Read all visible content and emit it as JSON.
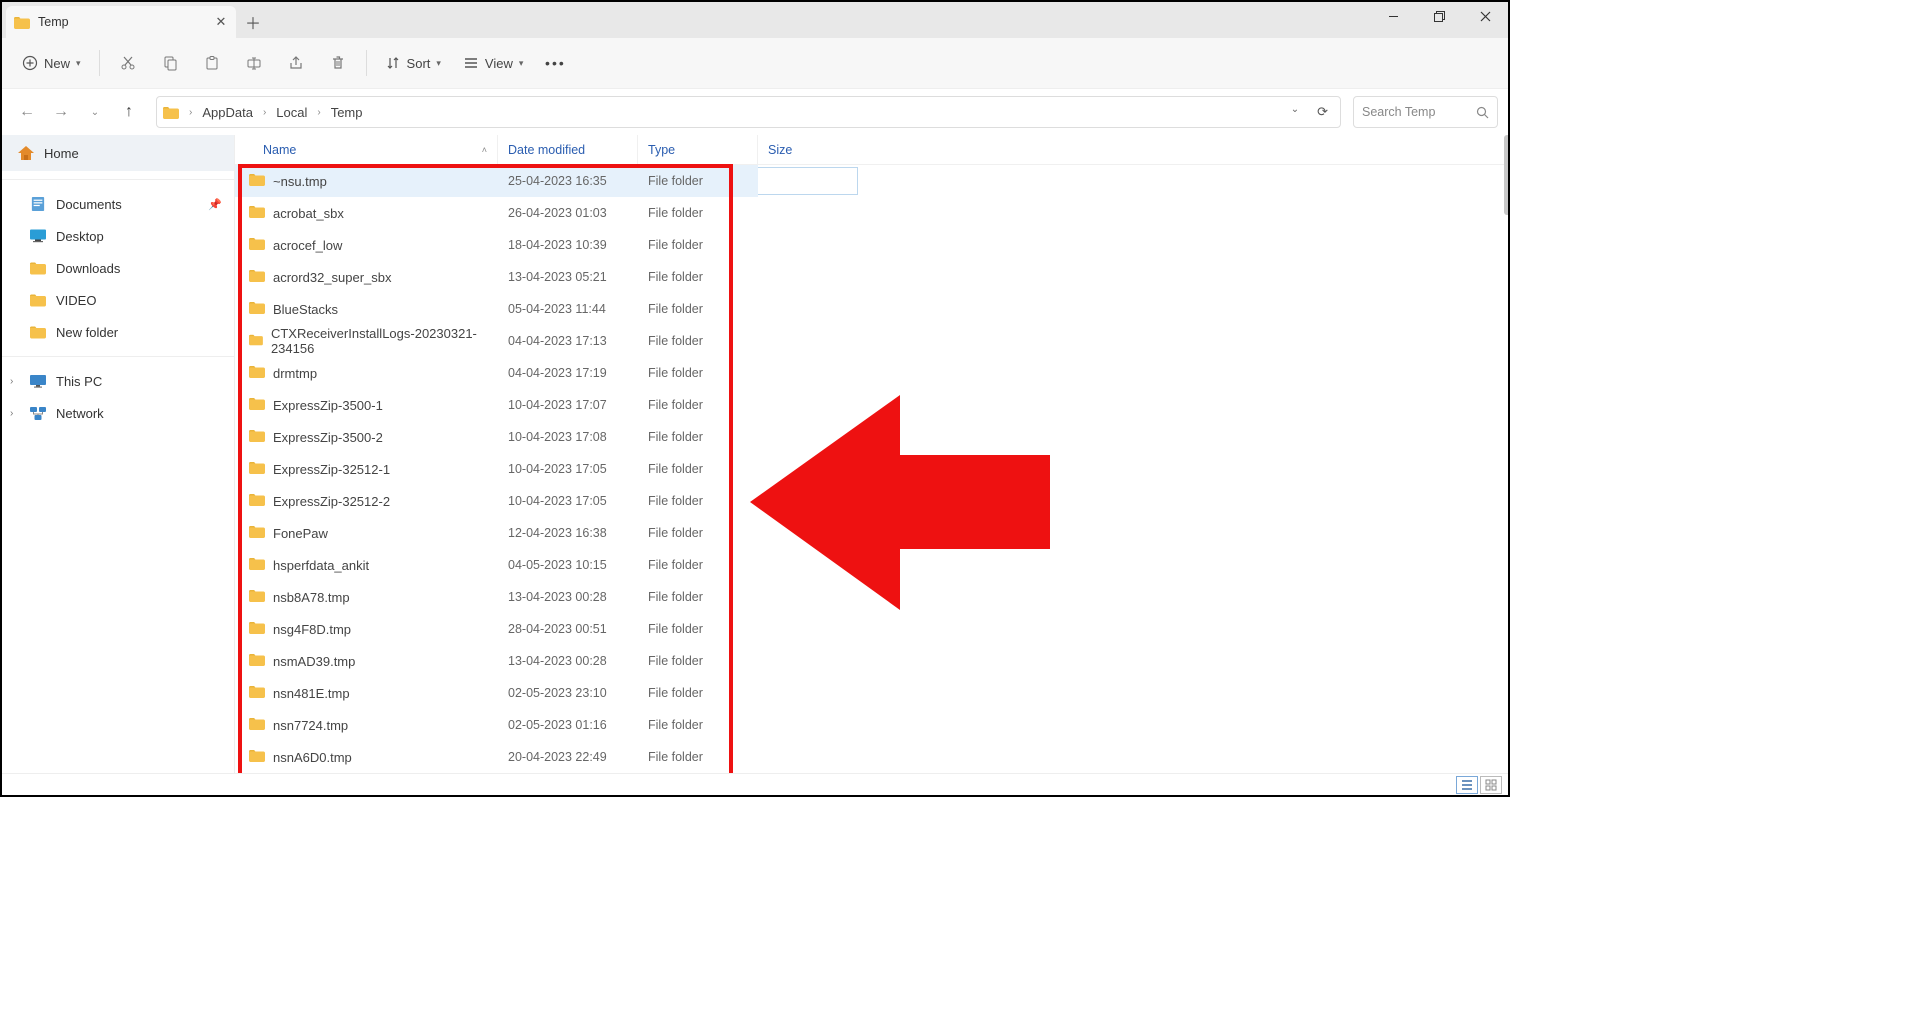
{
  "tab": {
    "title": "Temp"
  },
  "toolbar": {
    "new_label": "New",
    "sort_label": "Sort",
    "view_label": "View"
  },
  "breadcrumbs": [
    "AppData",
    "Local",
    "Temp"
  ],
  "search": {
    "placeholder": "Search Temp"
  },
  "sidebar": {
    "home": "Home",
    "quick": [
      {
        "label": "Documents",
        "pinned": true,
        "icon": "documents"
      },
      {
        "label": "Desktop",
        "pinned": false,
        "icon": "desktop"
      },
      {
        "label": "Downloads",
        "pinned": false,
        "icon": "folder"
      },
      {
        "label": "VIDEO",
        "pinned": false,
        "icon": "folder"
      },
      {
        "label": "New folder",
        "pinned": false,
        "icon": "folder"
      }
    ],
    "thispc": "This PC",
    "network": "Network"
  },
  "columns": {
    "name": "Name",
    "date": "Date modified",
    "type": "Type",
    "size": "Size"
  },
  "type_folder": "File folder",
  "files": [
    {
      "name": "~nsu.tmp",
      "date": "25-04-2023 16:35",
      "selected": true
    },
    {
      "name": "acrobat_sbx",
      "date": "26-04-2023 01:03"
    },
    {
      "name": "acrocef_low",
      "date": "18-04-2023 10:39"
    },
    {
      "name": "acrord32_super_sbx",
      "date": "13-04-2023 05:21"
    },
    {
      "name": "BlueStacks",
      "date": "05-04-2023 11:44"
    },
    {
      "name": "CTXReceiverInstallLogs-20230321-234156",
      "date": "04-04-2023 17:13"
    },
    {
      "name": "drmtmp",
      "date": "04-04-2023 17:19"
    },
    {
      "name": "ExpressZip-3500-1",
      "date": "10-04-2023 17:07"
    },
    {
      "name": "ExpressZip-3500-2",
      "date": "10-04-2023 17:08"
    },
    {
      "name": "ExpressZip-32512-1",
      "date": "10-04-2023 17:05"
    },
    {
      "name": "ExpressZip-32512-2",
      "date": "10-04-2023 17:05"
    },
    {
      "name": "FonePaw",
      "date": "12-04-2023 16:38"
    },
    {
      "name": "hsperfdata_ankit",
      "date": "04-05-2023 10:15"
    },
    {
      "name": "nsb8A78.tmp",
      "date": "13-04-2023 00:28"
    },
    {
      "name": "nsg4F8D.tmp",
      "date": "28-04-2023 00:51"
    },
    {
      "name": "nsmAD39.tmp",
      "date": "13-04-2023 00:28"
    },
    {
      "name": "nsn481E.tmp",
      "date": "02-05-2023 23:10"
    },
    {
      "name": "nsn7724.tmp",
      "date": "02-05-2023 01:16"
    },
    {
      "name": "nsnA6D0.tmp",
      "date": "20-04-2023 22:49"
    }
  ]
}
